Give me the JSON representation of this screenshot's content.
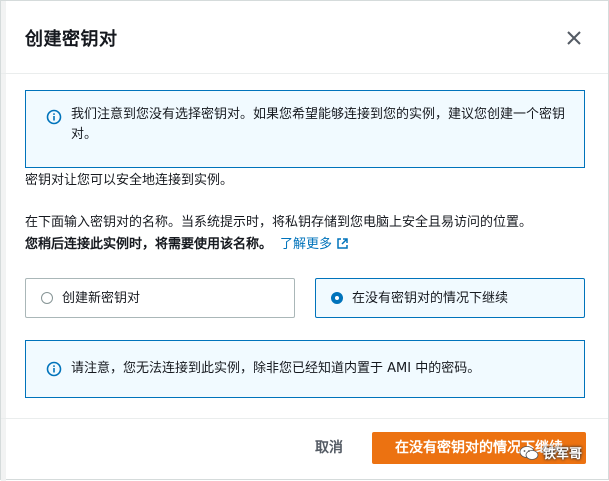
{
  "dialog": {
    "title": "创建密钥对"
  },
  "alerts": {
    "top": "我们注意到您没有选择密钥对。如果您希望能够连接到您的实例，建议您创建一个密钥对。",
    "bottom": "请注意，您无法连接到此实例，除非您已经知道内置于 AMI 中的密码。"
  },
  "body": {
    "intro": "密钥对让您可以安全地连接到实例。",
    "instruction": "在下面输入密钥对的名称。当系统提示时，将私钥存储到您电脑上安全且易访问的位置。",
    "notice": "您稍后连接此实例时，将需要使用该名称。",
    "learn_more": "了解更多"
  },
  "options": [
    {
      "label": "创建新密钥对",
      "selected": false
    },
    {
      "label": "在没有密钥对的情况下继续",
      "selected": true
    }
  ],
  "footer": {
    "cancel": "取消",
    "primary": "在没有密钥对的情况下继续"
  },
  "watermark": "铁军哥",
  "colors": {
    "accent": "#0073bb",
    "primary_button": "#ec7211",
    "alert_bg": "#f1faff"
  }
}
